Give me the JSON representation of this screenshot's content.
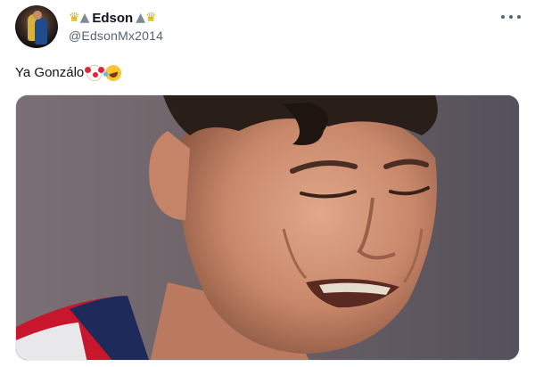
{
  "tweet": {
    "author": {
      "display_name": "Edson",
      "handle": "@EdsonMx2014",
      "name_emojis_left": [
        "crown-emoji",
        "mountain-emoji"
      ],
      "name_emojis_right": [
        "mountain-emoji",
        "crown-emoji"
      ]
    },
    "text": "Ya Gonzálo",
    "text_emojis": [
      "clown-face-emoji",
      "rolling-on-floor-laughing-emoji"
    ],
    "more_icon": "more-horizontal-icon",
    "media": {
      "type": "photo"
    }
  },
  "colors": {
    "text_primary": "#0f1419",
    "text_secondary": "#536471",
    "background": "#ffffff"
  }
}
